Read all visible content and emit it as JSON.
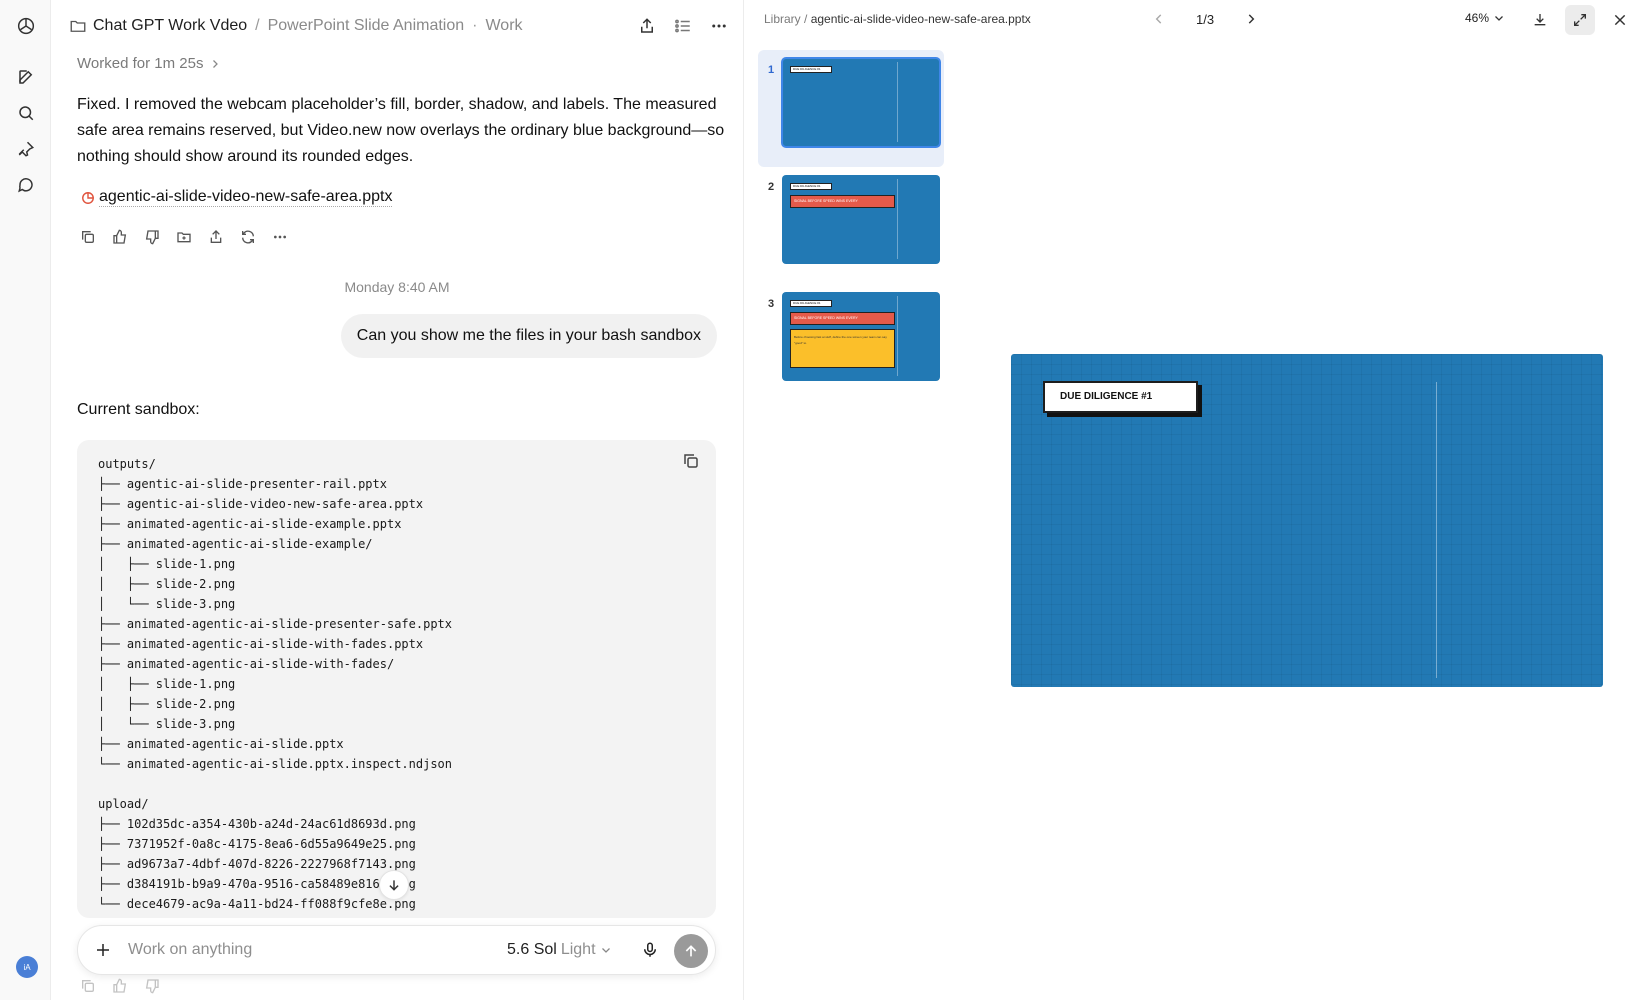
{
  "rail": {
    "icons": [
      "logo-icon",
      "new-chat-icon",
      "search-icon",
      "pin-icon",
      "chat-icon"
    ],
    "avatar": "iA"
  },
  "chat": {
    "header": {
      "project": "Chat GPT Work Vdeo",
      "title": "PowerPoint Slide Animation",
      "mode": "Work"
    },
    "worked": "Worked for 1m 25s",
    "assistant_message": "Fixed. I removed the webcam placeholder’s fill, border, shadow, and labels. The measured safe area remains reserved, but Video.new now overlays the ordinary blue background—so nothing should show around its rounded edges.",
    "attachment": "agentic-ai-slide-video-new-safe-area.pptx",
    "timestamp": "Monday 8:40 AM",
    "user_message": "Can you show me the files in your bash sandbox",
    "current_label": "Current sandbox:",
    "sandbox_listing": "outputs/\n├── agentic-ai-slide-presenter-rail.pptx\n├── agentic-ai-slide-video-new-safe-area.pptx\n├── animated-agentic-ai-slide-example.pptx\n├── animated-agentic-ai-slide-example/\n│   ├── slide-1.png\n│   ├── slide-2.png\n│   └── slide-3.png\n├── animated-agentic-ai-slide-presenter-safe.pptx\n├── animated-agentic-ai-slide-with-fades.pptx\n├── animated-agentic-ai-slide-with-fades/\n│   ├── slide-1.png\n│   ├── slide-2.png\n│   └── slide-3.png\n├── animated-agentic-ai-slide.pptx\n└── animated-agentic-ai-slide.pptx.inspect.ndjson\n\nupload/\n├── 102d35dc-a354-430b-a24d-24ac61d8693d.png\n├── 7371952f-0a8c-4175-8ea6-6d55a9649e25.png\n├── ad9673a7-4dbf-407d-8226-2227968f7143.png\n├── d384191b-b9a9-470a-9516-ca58489e816e.png\n└── dece4679-ac9a-4a11-bd24-ff088f9cfe8e.png",
    "composer": {
      "placeholder": "Work on anything",
      "model": "5.6 Sol",
      "effort": "Light"
    }
  },
  "preview": {
    "library": "Library",
    "filename": "agentic-ai-slide-video-new-safe-area.pptx",
    "page": "1/3",
    "zoom": "46%",
    "thumbnails": [
      {
        "num": "1",
        "label": "DUE DILIGENCE #1",
        "selected": true
      },
      {
        "num": "2",
        "label": "DUE DILIGENCE #1",
        "red": "SIGNAL BEFORE SPEED WINS EVERY",
        "selected": false
      },
      {
        "num": "3",
        "label": "DUE DILIGENCE #1",
        "red": "SIGNAL BEFORE SPEED WINS EVERY",
        "yellow": "Before choosing fast ai stuff, define the one screen your team can say \"good\" to.",
        "selected": false
      }
    ],
    "slide": {
      "tag": "DUE DILIGENCE #1"
    }
  },
  "colors": {
    "slide_blue": "#2279b4",
    "accent_red": "#e45a4a",
    "accent_yellow": "#fbbf2a",
    "selection_blue": "#3f86e8"
  }
}
